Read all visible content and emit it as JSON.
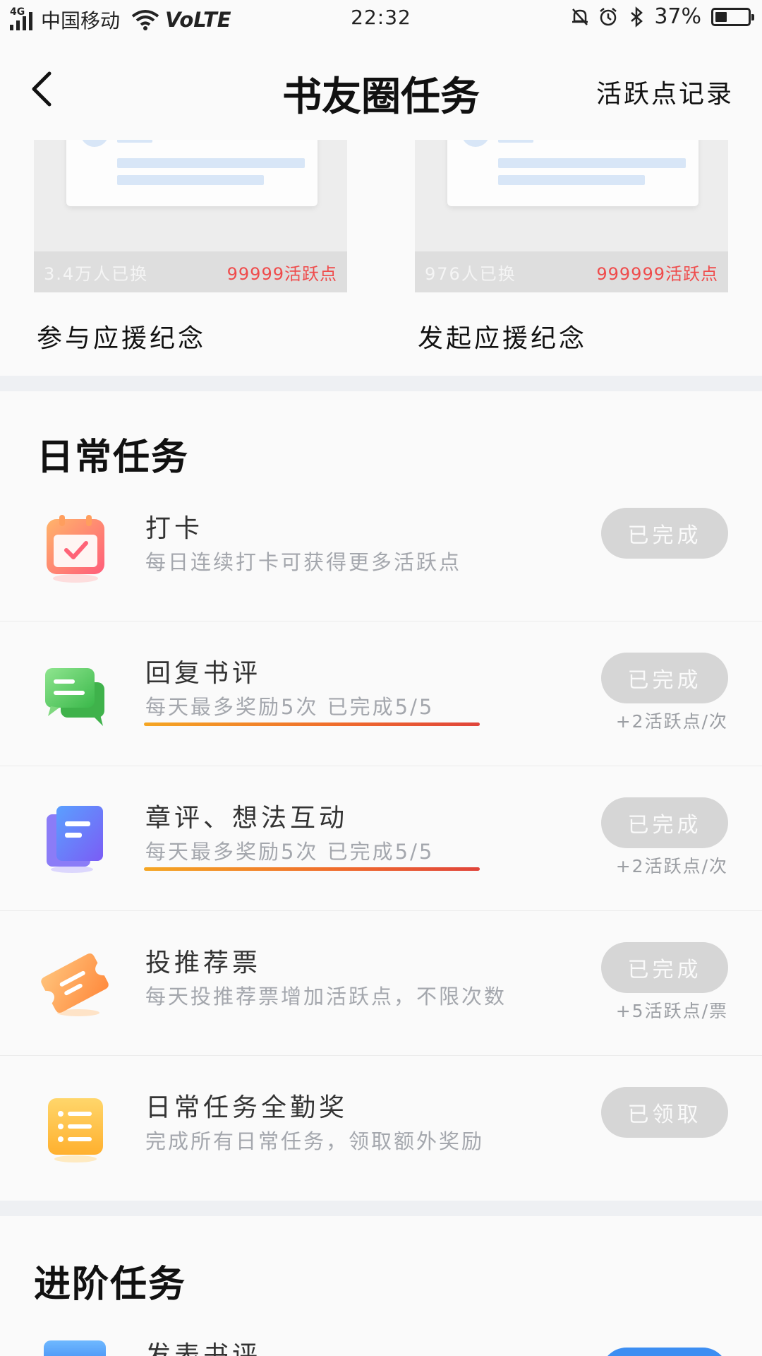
{
  "status_bar": {
    "network": "4G",
    "carrier": "中国移动",
    "volte": "VoLTE",
    "time": "22:32",
    "battery_pct": "37%",
    "battery_level": 0.37
  },
  "nav": {
    "title": "书友圈任务",
    "action_label": "活跃点记录"
  },
  "redeem_items": [
    {
      "count": "3.4万人已换",
      "cost": "99999活跃点",
      "name": "参与应援纪念"
    },
    {
      "count": "976人已换",
      "cost": "999999活跃点",
      "name": "发起应援纪念"
    }
  ],
  "daily": {
    "title": "日常任务",
    "tasks": [
      {
        "icon": "calendar-check-icon",
        "title": "打卡",
        "desc": "每日连续打卡可获得更多活跃点",
        "status": "已完成",
        "reward": ""
      },
      {
        "icon": "chat-bubbles-icon",
        "title": "回复书评",
        "desc": "每天最多奖励5次  已完成5/5",
        "status": "已完成",
        "reward": "+2活跃点/次"
      },
      {
        "icon": "document-icon",
        "title": "章评、想法互动",
        "desc": "每天最多奖励5次  已完成5/5",
        "status": "已完成",
        "reward": "+2活跃点/次"
      },
      {
        "icon": "ticket-icon",
        "title": "投推荐票",
        "desc": "每天投推荐票增加活跃点，不限次数",
        "status": "已完成",
        "reward": "+5活跃点/票"
      },
      {
        "icon": "list-icon",
        "title": "日常任务全勤奖",
        "desc": "完成所有日常任务，领取额外奖励",
        "status": "已领取",
        "reward": ""
      }
    ]
  },
  "advanced": {
    "title": "进阶任务",
    "first_task_title": "发表书评"
  },
  "colors": {
    "background": "#fafafa",
    "done_button": "#d6d6d6",
    "cost_red": "#ef4b4b",
    "accent_blue": "#3d8ef2",
    "underline_orange": "#ef6a2d"
  }
}
